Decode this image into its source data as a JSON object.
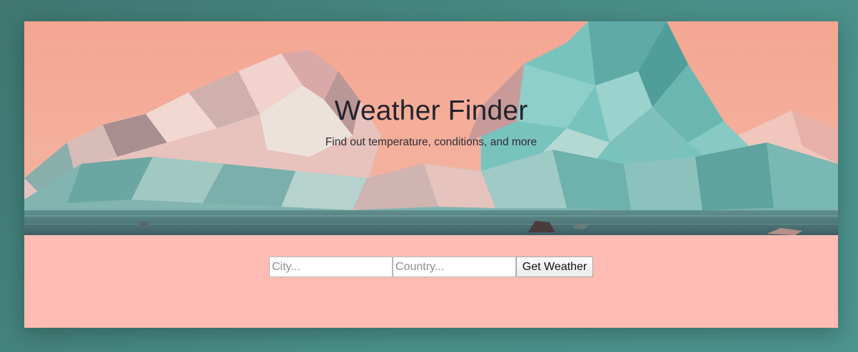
{
  "hero": {
    "title": "Weather Finder",
    "subtitle": "Find out temperature, conditions, and more"
  },
  "form": {
    "city_placeholder": "City...",
    "country_placeholder": "Country...",
    "submit_label": "Get Weather"
  },
  "colors": {
    "page_background": "#4a8f89",
    "card_background": "#febcb4",
    "sky": "#f4a894",
    "mountain_teal": "#6fbab5",
    "title_text": "#23232b"
  }
}
